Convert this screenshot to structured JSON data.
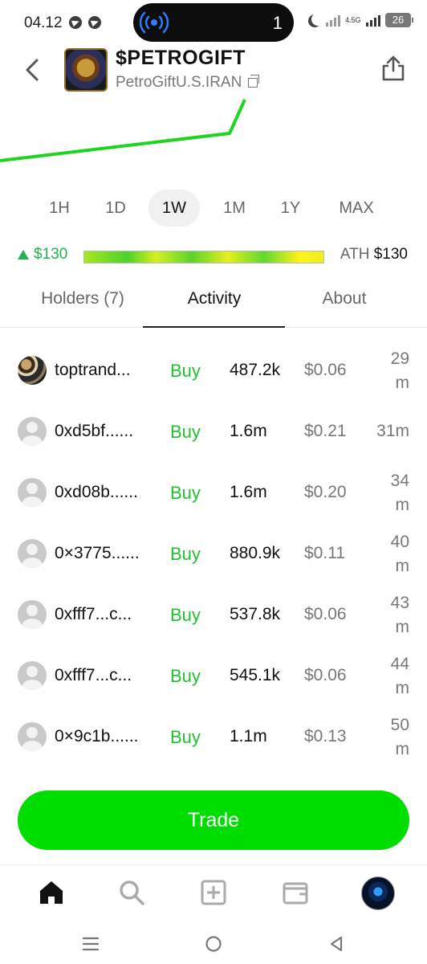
{
  "status_bar": {
    "time": "04.12",
    "live_count": "1",
    "network_label": "4.5G",
    "battery": "26"
  },
  "header": {
    "title": "$PETROGIFT",
    "subtitle": "PetroGiftU.S.IRAN"
  },
  "time_ranges": [
    {
      "label": "1H",
      "active": false
    },
    {
      "label": "1D",
      "active": false
    },
    {
      "label": "1W",
      "active": true
    },
    {
      "label": "1M",
      "active": false
    },
    {
      "label": "1Y",
      "active": false
    },
    {
      "label": "MAX",
      "active": false
    }
  ],
  "price": {
    "change": "$130",
    "ath_label": "ATH",
    "ath_value": "$130",
    "accent_color": "#22b24c"
  },
  "tabs": [
    {
      "label": "Holders (7)",
      "active": false
    },
    {
      "label": "Activity",
      "active": true
    },
    {
      "label": "About",
      "active": false
    }
  ],
  "activity": [
    {
      "name": "toptrand...",
      "type": "Buy",
      "amount": "487.2k",
      "price": "$0.06",
      "time_value": "29",
      "time_unit": "m",
      "avatar": "user-photo"
    },
    {
      "name": "0xd5bf......",
      "type": "Buy",
      "amount": "1.6m",
      "price": "$0.21",
      "time_value": "31m",
      "time_unit": "",
      "avatar": "default-avatar"
    },
    {
      "name": "0xd08b......",
      "type": "Buy",
      "amount": "1.6m",
      "price": "$0.20",
      "time_value": "34",
      "time_unit": "m",
      "avatar": "default-avatar"
    },
    {
      "name": "0×3775......",
      "type": "Buy",
      "amount": "880.9k",
      "price": "$0.11",
      "time_value": "40",
      "time_unit": "m",
      "avatar": "default-avatar"
    },
    {
      "name": "0xfff7...c...",
      "type": "Buy",
      "amount": "537.8k",
      "price": "$0.06",
      "time_value": "43",
      "time_unit": "m",
      "avatar": "default-avatar"
    },
    {
      "name": "0xfff7...c...",
      "type": "Buy",
      "amount": "545.1k",
      "price": "$0.06",
      "time_value": "44",
      "time_unit": "m",
      "avatar": "default-avatar"
    },
    {
      "name": "0×9c1b......",
      "type": "Buy",
      "amount": "1.1m",
      "price": "$0.13",
      "time_value": "50",
      "time_unit": "m",
      "avatar": "default-avatar"
    }
  ],
  "trade_button": {
    "label": "Trade",
    "color": "#00dd00"
  },
  "bottom_nav": [
    "home-icon",
    "search-icon",
    "add-icon",
    "wallet-icon",
    "profile-avatar"
  ],
  "system_nav": [
    "recents-icon",
    "home-circle-icon",
    "back-triangle-icon"
  ]
}
